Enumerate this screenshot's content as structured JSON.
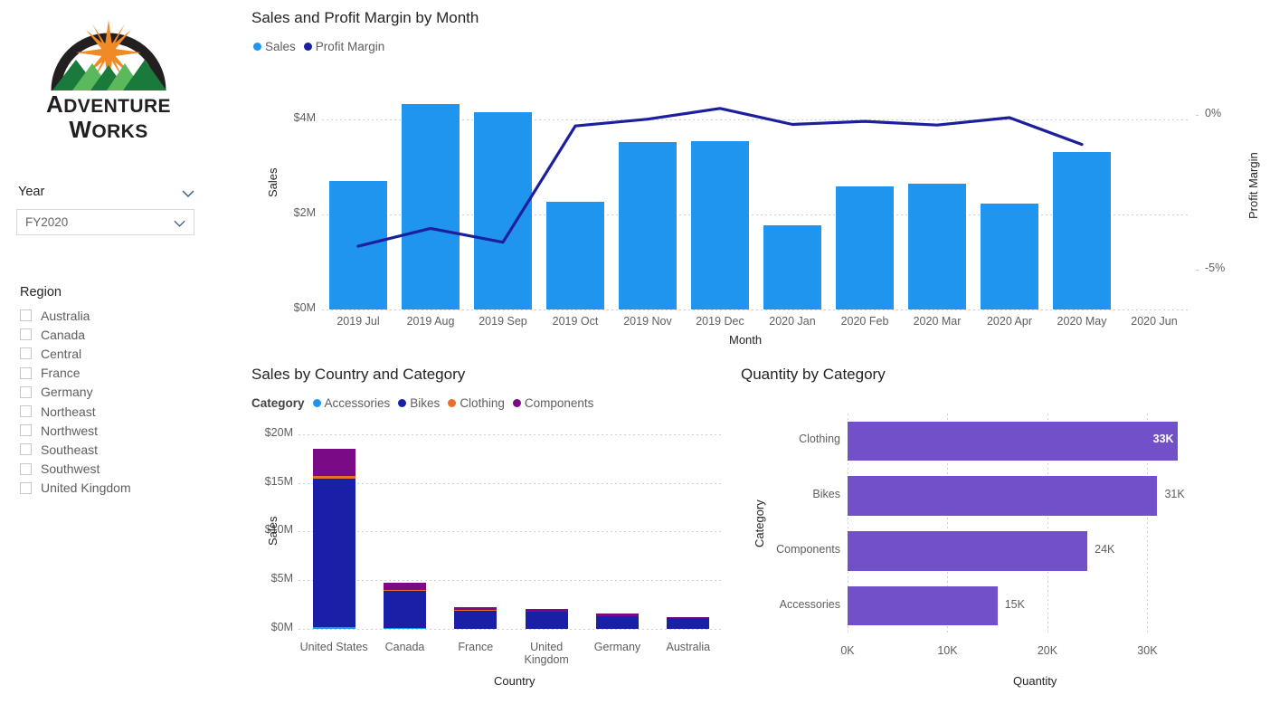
{
  "brand": {
    "logo_line1": "Adventure",
    "logo_line2": "Works",
    "colors": {
      "arc": "#231f20",
      "star": "#f08a24",
      "mountain_dark": "#1a7a3c",
      "mountain_light": "#5cb85c"
    }
  },
  "filters": {
    "year": {
      "label": "Year",
      "value": "FY2020",
      "chevron_icon": "chevron-down-icon"
    },
    "region": {
      "label": "Region",
      "items": [
        {
          "label": "Australia",
          "checked": false
        },
        {
          "label": "Canada",
          "checked": false
        },
        {
          "label": "Central",
          "checked": false
        },
        {
          "label": "France",
          "checked": false
        },
        {
          "label": "Germany",
          "checked": false
        },
        {
          "label": "Northeast",
          "checked": false
        },
        {
          "label": "Northwest",
          "checked": false
        },
        {
          "label": "Southeast",
          "checked": false
        },
        {
          "label": "Southwest",
          "checked": false
        },
        {
          "label": "United Kingdom",
          "checked": false
        }
      ]
    }
  },
  "chart_data": [
    {
      "id": "sales_profit_by_month",
      "type": "bar",
      "title": "Sales and Profit Margin by Month",
      "xlabel": "Month",
      "ylabel": "Sales",
      "y2label": "Profit Margin",
      "grid": true,
      "legend_position": "top-left",
      "legend": [
        {
          "name": "Sales",
          "color": "#1f95f0"
        },
        {
          "name": "Profit Margin",
          "color": "#1b1f9e"
        }
      ],
      "categories": [
        "2019 Jul",
        "2019 Aug",
        "2019 Sep",
        "2019 Oct",
        "2019 Nov",
        "2019 Dec",
        "2020 Jan",
        "2020 Feb",
        "2020 Mar",
        "2020 Apr",
        "2020 May",
        "2020 Jun"
      ],
      "ylim": [
        0,
        4.6
      ],
      "yticks": [
        0,
        2,
        4
      ],
      "yticklabels": [
        "$0M",
        "$2M",
        "$4M"
      ],
      "y2lim": [
        -6.3,
        0.8
      ],
      "y2ticks": [
        0,
        -5
      ],
      "y2ticklabels": [
        "0%",
        "-5%"
      ],
      "series": [
        {
          "name": "Sales",
          "chart": "bar",
          "color": "#1f95f0",
          "values": [
            2.7,
            4.32,
            4.15,
            2.26,
            3.52,
            3.53,
            1.77,
            2.58,
            2.65,
            2.22,
            3.3,
            null
          ]
        },
        {
          "name": "Profit Margin",
          "chart": "line",
          "color": "#1b1f9e",
          "values": [
            -4.25,
            -3.67,
            -4.12,
            -0.35,
            -0.13,
            0.22,
            -0.3,
            -0.2,
            -0.32,
            -0.08,
            -0.95,
            null
          ]
        }
      ]
    },
    {
      "id": "sales_by_country_category",
      "type": "bar",
      "title": "Sales by Country and Category",
      "xlabel": "Country",
      "ylabel": "Sales",
      "grid": true,
      "stacked": true,
      "legend_position": "top-left",
      "legend_header": "Category",
      "legend": [
        {
          "name": "Accessories",
          "color": "#1f95f0"
        },
        {
          "name": "Bikes",
          "color": "#1a1fa8"
        },
        {
          "name": "Clothing",
          "color": "#e8702a"
        },
        {
          "name": "Components",
          "color": "#7b0a87"
        }
      ],
      "categories": [
        "United States",
        "Canada",
        "France",
        "United Kingdom",
        "Germany",
        "Australia"
      ],
      "ylim": [
        0,
        21.2
      ],
      "yticks": [
        0,
        5,
        10,
        15,
        20
      ],
      "yticklabels": [
        "$0M",
        "$5M",
        "$10M",
        "$15M",
        "$20M"
      ],
      "series": [
        {
          "name": "Accessories",
          "color": "#1f95f0",
          "values": [
            0.21,
            0.06,
            0.03,
            0.03,
            0.02,
            0.02
          ]
        },
        {
          "name": "Bikes",
          "color": "#1a1fa8",
          "values": [
            15.2,
            3.8,
            1.82,
            1.7,
            1.26,
            1.05
          ]
        },
        {
          "name": "Clothing",
          "color": "#e8702a",
          "values": [
            0.3,
            0.12,
            0.07,
            0.07,
            0.05,
            0.04
          ]
        },
        {
          "name": "Components",
          "color": "#7b0a87",
          "values": [
            2.8,
            0.75,
            0.33,
            0.26,
            0.21,
            0.13
          ]
        }
      ]
    },
    {
      "id": "quantity_by_category",
      "type": "bar",
      "orientation": "horizontal",
      "title": "Quantity by Category",
      "xlabel": "Quantity",
      "ylabel": "Category",
      "grid": true,
      "bar_color": "#7150c9",
      "categories": [
        "Clothing",
        "Bikes",
        "Components",
        "Accessories"
      ],
      "values": [
        33000,
        31000,
        24000,
        15000
      ],
      "value_labels": [
        "33K",
        "31K",
        "24K",
        "15K"
      ],
      "label_inside": [
        true,
        false,
        false,
        false
      ],
      "xlim": [
        0,
        33400
      ],
      "xticks": [
        0,
        10000,
        20000,
        30000
      ],
      "xticklabels": [
        "0K",
        "10K",
        "20K",
        "30K"
      ]
    }
  ]
}
